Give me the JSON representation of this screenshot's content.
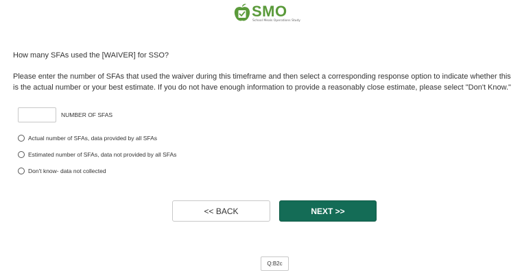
{
  "logo": {
    "icon": "apple-checkbox-icon",
    "name": "SMO",
    "tagline": "School Meals Operations Study",
    "brand_color": "#5a9a3a"
  },
  "question": {
    "text": "How many SFAs used the [WAIVER] for SSO?",
    "instructions": "Please enter the number of SFAs that used the waiver during this timeframe and then select a corresponding response option to indicate whether this is the actual number or your best estimate. If you do not have enough information to provide a reasonably close estimate, please select \"Don't Know.\""
  },
  "number_field": {
    "value": "",
    "label": "NUMBER OF SFAS"
  },
  "options": [
    {
      "label": "Actual number of SFAs, data provided by all SFAs",
      "selected": false
    },
    {
      "label": "Estimated number of SFAs, data not provided by all SFAs",
      "selected": false
    },
    {
      "label": "Don't know- data not collected",
      "selected": false
    }
  ],
  "nav": {
    "back_label": "<< BACK",
    "next_label": "NEXT >>",
    "next_color": "#146c56"
  },
  "question_id": "Q:B2c"
}
